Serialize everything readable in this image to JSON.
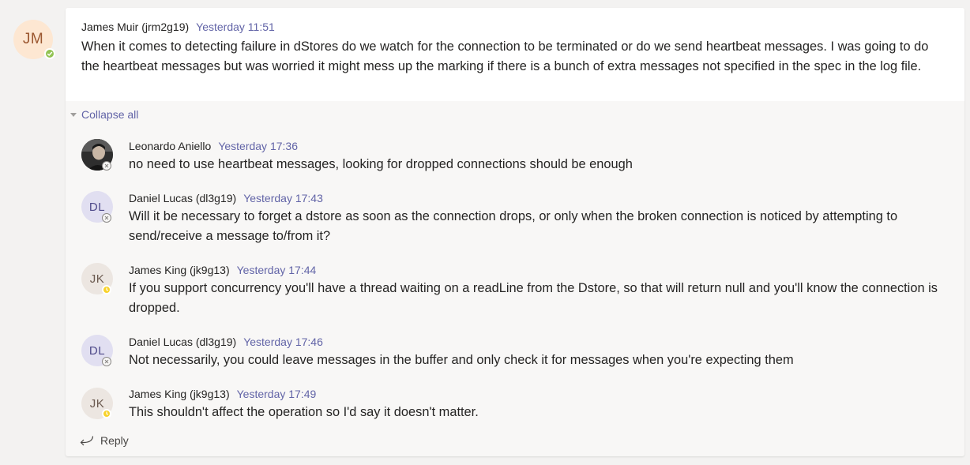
{
  "root": {
    "avatar_initials": "JM",
    "author": "James Muir (jrm2g19)",
    "timestamp": "Yesterday 11:51",
    "text": "When it comes to detecting failure in dStores do we watch for the connection to be terminated or do we send heartbeat messages. I was going to do the heartbeat messages but was worried it might mess up the marking if there is a bunch of extra messages not specified in the spec in the log file.",
    "presence": "available"
  },
  "collapse_label": "Collapse all",
  "replies": [
    {
      "author": "Leonardo Aniello",
      "timestamp": "Yesterday 17:36",
      "text": "no need to use heartbeat messages, looking for dropped connections should be enough",
      "avatar_initials": "",
      "avatar_type": "photo",
      "presence": "offline"
    },
    {
      "author": "Daniel Lucas (dl3g19)",
      "timestamp": "Yesterday 17:43",
      "text": "Will it be necessary to forget a dstore as soon as the connection drops, or only when the broken connection is noticed by attempting to send/receive a message to/from it?",
      "avatar_initials": "DL",
      "presence": "offline"
    },
    {
      "author": "James King (jk9g13)",
      "timestamp": "Yesterday 17:44",
      "text": "If you support concurrency you'll have a thread waiting on a readLine from the Dstore, so that will return null and you'll know the connection is dropped.",
      "avatar_initials": "JK",
      "presence": "away"
    },
    {
      "author": "Daniel Lucas (dl3g19)",
      "timestamp": "Yesterday 17:46",
      "text": "Not necessarily, you could leave messages in the buffer and only check it for messages when you're expecting them",
      "avatar_initials": "DL",
      "presence": "offline"
    },
    {
      "author": "James King (jk9g13)",
      "timestamp": "Yesterday 17:49",
      "text": "This shouldn't affect the operation so I'd say it doesn't matter.",
      "avatar_initials": "JK",
      "presence": "away"
    }
  ],
  "reply_label": "Reply",
  "colors": {
    "accent": "#6264a7",
    "available": "#92c353",
    "away": "#f8d22a",
    "jm_bg": "#fde7d2",
    "jm_fg": "#9b5730",
    "dl_bg": "#e1dff1",
    "dl_fg": "#4f4a8a",
    "jk_bg": "#ece6e1",
    "jk_fg": "#6b5a50"
  }
}
